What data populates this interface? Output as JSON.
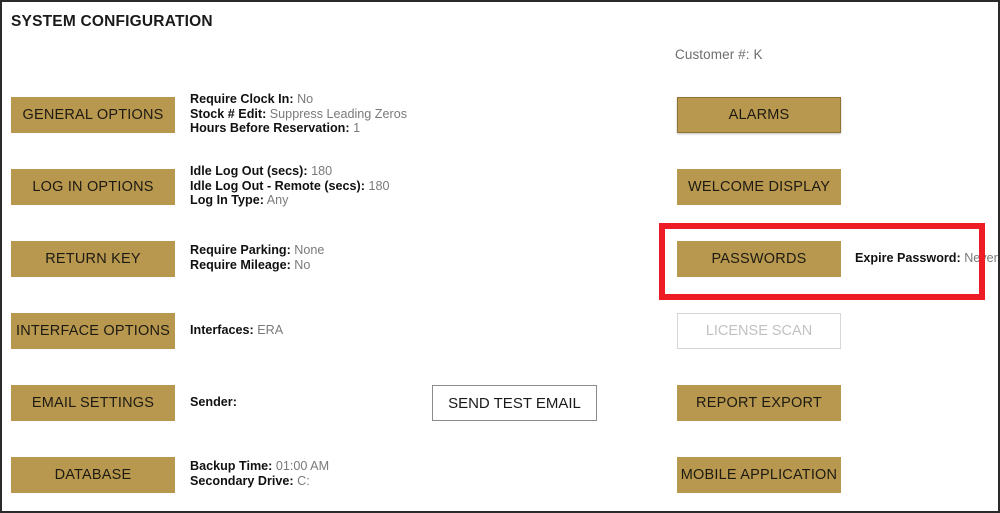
{
  "window": {
    "title": "SYSTEM CONFIGURATION"
  },
  "header": {
    "customer_label": "Customer #: K"
  },
  "colors": {
    "button_gold": "#b8984f",
    "highlight_red": "#ee1c24",
    "label_black": "#111111",
    "value_gray": "#7a7a7a",
    "disabled_gray": "#c2c2c2"
  },
  "left_column": [
    {
      "button_label": "GENERAL OPTIONS",
      "details": [
        {
          "label": "Require Clock In:",
          "value": "No"
        },
        {
          "label": "Stock # Edit:",
          "value": "Suppress Leading Zeros"
        },
        {
          "label": "Hours Before Reservation:",
          "value": "1"
        }
      ]
    },
    {
      "button_label": "LOG IN OPTIONS",
      "details": [
        {
          "label": "Idle Log Out (secs):",
          "value": "180"
        },
        {
          "label": "Idle Log Out - Remote (secs):",
          "value": "180"
        },
        {
          "label": "Log In Type:",
          "value": "Any"
        }
      ]
    },
    {
      "button_label": "RETURN KEY",
      "details": [
        {
          "label": "Require Parking:",
          "value": "None"
        },
        {
          "label": "Require Mileage:",
          "value": "No"
        }
      ]
    },
    {
      "button_label": "INTERFACE OPTIONS",
      "details": [
        {
          "label": "Interfaces:",
          "value": "ERA"
        }
      ]
    },
    {
      "button_label": "EMAIL SETTINGS",
      "details": [
        {
          "label": "Sender:",
          "value": ""
        }
      ]
    },
    {
      "button_label": "DATABASE",
      "details": [
        {
          "label": "Backup Time:",
          "value": "01:00 AM"
        },
        {
          "label": "Secondary Drive:",
          "value": "C:"
        }
      ]
    }
  ],
  "center": {
    "send_test_email_label": "SEND TEST EMAIL"
  },
  "right_column": [
    {
      "button_label": "ALARMS",
      "state": "focused",
      "details": []
    },
    {
      "button_label": "WELCOME DISPLAY",
      "state": "normal",
      "details": []
    },
    {
      "button_label": "PASSWORDS",
      "state": "normal",
      "details": [
        {
          "label": "Expire Password:",
          "value": "Never"
        }
      ]
    },
    {
      "button_label": "LICENSE SCAN",
      "state": "disabled",
      "details": []
    },
    {
      "button_label": "REPORT EXPORT",
      "state": "normal",
      "details": []
    },
    {
      "button_label": "MOBILE APPLICATION",
      "state": "normal",
      "details": []
    }
  ],
  "annotation": {
    "highlight_target": "PASSWORDS"
  }
}
